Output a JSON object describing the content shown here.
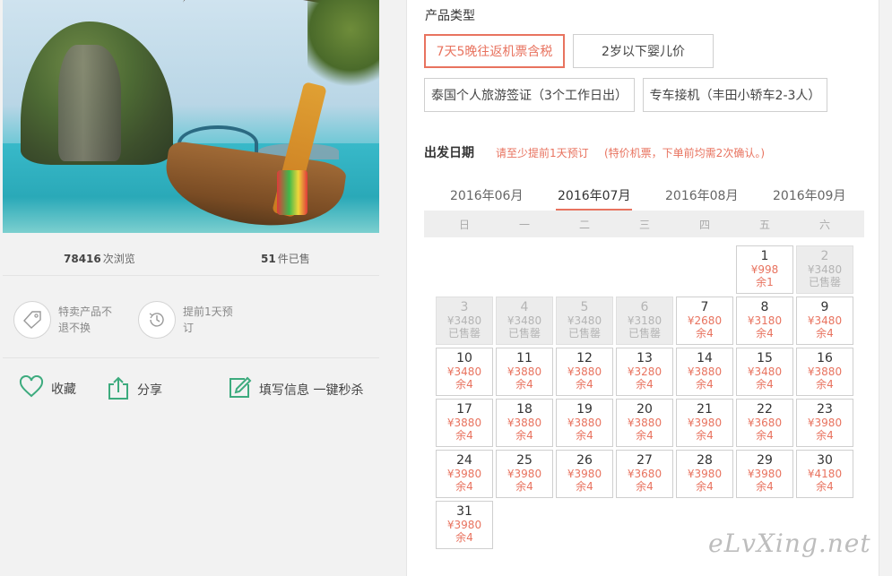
{
  "stats": {
    "views_num": "78416",
    "views_label": "次浏览",
    "sold_num": "51",
    "sold_label": "件已售"
  },
  "features": [
    {
      "icon": "tag-icon",
      "text": "特卖产品不退不换"
    },
    {
      "icon": "clock-icon",
      "text": "提前1天预订"
    }
  ],
  "actions": [
    {
      "icon": "heart-icon",
      "label": "收藏"
    },
    {
      "icon": "share-icon",
      "label": "分享"
    },
    {
      "icon": "edit-icon",
      "label": "填写信息 一键秒杀"
    }
  ],
  "product_type": {
    "title": "产品类型",
    "options": [
      {
        "label": "7天5晚往返机票含税",
        "selected": true
      },
      {
        "label": "2岁以下婴儿价",
        "selected": false
      },
      {
        "label": "泰国个人旅游签证（3个工作日出）",
        "selected": false
      },
      {
        "label": "专车接机（丰田小轿车2-3人）",
        "selected": false
      }
    ]
  },
  "departure": {
    "title": "出发日期",
    "note1": "请至少提前1天预订",
    "note2": "(特价机票，下单前均需2次确认。)",
    "months": [
      "2016年06月",
      "2016年07月",
      "2016年08月",
      "2016年09月"
    ],
    "active_month": 1,
    "weekdays": [
      "日",
      "一",
      "二",
      "三",
      "四",
      "五",
      "六"
    ],
    "days": [
      {
        "d": "1",
        "p": "¥998",
        "s": "余1",
        "col": 5,
        "row": 0,
        "out": false
      },
      {
        "d": "2",
        "p": "¥3480",
        "s": "已售罄",
        "col": 6,
        "row": 0,
        "out": true
      },
      {
        "d": "3",
        "p": "¥3480",
        "s": "已售罄",
        "col": 0,
        "row": 1,
        "out": true
      },
      {
        "d": "4",
        "p": "¥3480",
        "s": "已售罄",
        "col": 1,
        "row": 1,
        "out": true
      },
      {
        "d": "5",
        "p": "¥3480",
        "s": "已售罄",
        "col": 2,
        "row": 1,
        "out": true
      },
      {
        "d": "6",
        "p": "¥3180",
        "s": "已售罄",
        "col": 3,
        "row": 1,
        "out": true
      },
      {
        "d": "7",
        "p": "¥2680",
        "s": "余4",
        "col": 4,
        "row": 1,
        "out": false
      },
      {
        "d": "8",
        "p": "¥3180",
        "s": "余4",
        "col": 5,
        "row": 1,
        "out": false
      },
      {
        "d": "9",
        "p": "¥3480",
        "s": "余4",
        "col": 6,
        "row": 1,
        "out": false
      },
      {
        "d": "10",
        "p": "¥3480",
        "s": "余4",
        "col": 0,
        "row": 2,
        "out": false
      },
      {
        "d": "11",
        "p": "¥3880",
        "s": "余4",
        "col": 1,
        "row": 2,
        "out": false
      },
      {
        "d": "12",
        "p": "¥3880",
        "s": "余4",
        "col": 2,
        "row": 2,
        "out": false
      },
      {
        "d": "13",
        "p": "¥3280",
        "s": "余4",
        "col": 3,
        "row": 2,
        "out": false
      },
      {
        "d": "14",
        "p": "¥3880",
        "s": "余4",
        "col": 4,
        "row": 2,
        "out": false
      },
      {
        "d": "15",
        "p": "¥3480",
        "s": "余4",
        "col": 5,
        "row": 2,
        "out": false
      },
      {
        "d": "16",
        "p": "¥3880",
        "s": "余4",
        "col": 6,
        "row": 2,
        "out": false
      },
      {
        "d": "17",
        "p": "¥3880",
        "s": "余4",
        "col": 0,
        "row": 3,
        "out": false
      },
      {
        "d": "18",
        "p": "¥3880",
        "s": "余4",
        "col": 1,
        "row": 3,
        "out": false
      },
      {
        "d": "19",
        "p": "¥3880",
        "s": "余4",
        "col": 2,
        "row": 3,
        "out": false
      },
      {
        "d": "20",
        "p": "¥3880",
        "s": "余4",
        "col": 3,
        "row": 3,
        "out": false
      },
      {
        "d": "21",
        "p": "¥3980",
        "s": "余4",
        "col": 4,
        "row": 3,
        "out": false
      },
      {
        "d": "22",
        "p": "¥3680",
        "s": "余4",
        "col": 5,
        "row": 3,
        "out": false
      },
      {
        "d": "23",
        "p": "¥3980",
        "s": "余4",
        "col": 6,
        "row": 3,
        "out": false
      },
      {
        "d": "24",
        "p": "¥3980",
        "s": "余4",
        "col": 0,
        "row": 4,
        "out": false
      },
      {
        "d": "25",
        "p": "¥3980",
        "s": "余4",
        "col": 1,
        "row": 4,
        "out": false
      },
      {
        "d": "26",
        "p": "¥3980",
        "s": "余4",
        "col": 2,
        "row": 4,
        "out": false
      },
      {
        "d": "27",
        "p": "¥3680",
        "s": "余4",
        "col": 3,
        "row": 4,
        "out": false
      },
      {
        "d": "28",
        "p": "¥3980",
        "s": "余4",
        "col": 4,
        "row": 4,
        "out": false
      },
      {
        "d": "29",
        "p": "¥3980",
        "s": "余4",
        "col": 5,
        "row": 4,
        "out": false
      },
      {
        "d": "30",
        "p": "¥4180",
        "s": "余4",
        "col": 6,
        "row": 4,
        "out": false
      },
      {
        "d": "31",
        "p": "¥3980",
        "s": "余4",
        "col": 0,
        "row": 5,
        "out": false
      }
    ]
  },
  "watermark": "eLvXing.net",
  "colors": {
    "accent": "#e8735f",
    "icon_green": "#3dab7e"
  }
}
